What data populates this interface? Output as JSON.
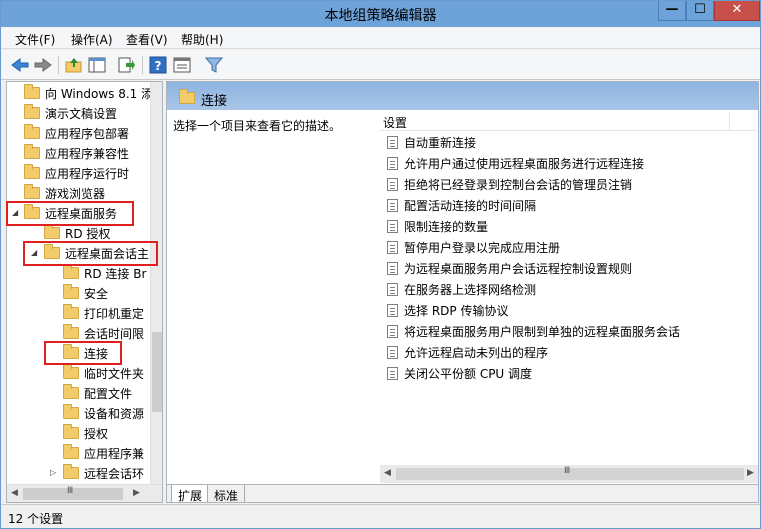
{
  "window": {
    "title": "本地组策略编辑器",
    "controls": {
      "minimize": "—",
      "maximize": "☐",
      "close": "✕"
    }
  },
  "menubar": [
    {
      "label": "文件(F)"
    },
    {
      "label": "操作(A)"
    },
    {
      "label": "查看(V)"
    },
    {
      "label": "帮助(H)"
    }
  ],
  "toolbar": {
    "icons": [
      "back-arrow-icon",
      "forward-arrow-icon",
      "up-folder-icon",
      "show-hide-tree-icon",
      "export-list-icon",
      "help-icon",
      "properties-icon",
      "filter-icon"
    ]
  },
  "tree": {
    "items": [
      {
        "label": "向 Windows 8.1 添"
      },
      {
        "label": "演示文稿设置"
      },
      {
        "label": "应用程序包部署"
      },
      {
        "label": "应用程序兼容性"
      },
      {
        "label": "应用程序运行时"
      },
      {
        "label": "游戏浏览器"
      },
      {
        "label": "远程桌面服务"
      },
      {
        "label": "RD 授权"
      },
      {
        "label": "远程桌面会话主"
      },
      {
        "label": "RD 连接 Br"
      },
      {
        "label": "安全"
      },
      {
        "label": "打印机重定"
      },
      {
        "label": "会话时间限"
      },
      {
        "label": "连接"
      },
      {
        "label": "临时文件夹"
      },
      {
        "label": "配置文件"
      },
      {
        "label": "设备和资源"
      },
      {
        "label": "授权"
      },
      {
        "label": "应用程序兼"
      },
      {
        "label": "远程会话环"
      }
    ],
    "scrollbar_glyph": "Ⅲ"
  },
  "right": {
    "header_title": "连接",
    "description": "选择一个项目来查看它的描述。",
    "column_setting": "设置",
    "settings": [
      "自动重新连接",
      "允许用户通过使用远程桌面服务进行远程连接",
      "拒绝将已经登录到控制台会话的管理员注销",
      "配置活动连接的时间间隔",
      "限制连接的数量",
      "暂停用户登录以完成应用注册",
      "为远程桌面服务用户会话远程控制设置规则",
      "在服务器上选择网络检测",
      "选择 RDP 传输协议",
      "将远程桌面服务用户限制到单独的远程桌面服务会话",
      "允许远程启动未列出的程序",
      "关闭公平份额 CPU 调度"
    ],
    "tabs": {
      "extended": "扩展",
      "standard": "标准"
    }
  },
  "status": {
    "text": "12 个设置"
  },
  "colors": {
    "highlight_box": "#e02020",
    "title_bar": "#6ea3da",
    "close_button": "#c7504a"
  }
}
